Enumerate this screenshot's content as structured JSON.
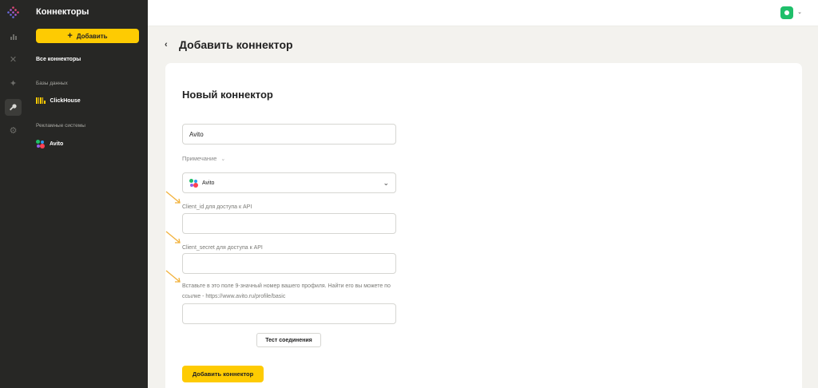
{
  "sidebar": {
    "title": "Коннекторы",
    "add_label": "Добавить",
    "all_connectors": "Все коннекторы",
    "databases_section": "Базы данных",
    "clickhouse_label": "ClickHouse",
    "ads_section": "Рекламные системы",
    "avito_label": "Avito"
  },
  "header": {
    "back_glyph": "‹",
    "page_title": "Добавить коннектор"
  },
  "form": {
    "title": "Новый коннектор",
    "name_value": "Avito",
    "note_label": "Примечание",
    "source_selected": "Avito",
    "client_id_label": "Client_id для доступа к API",
    "client_id_value": "",
    "client_secret_label": "Client_secret для доступа к API",
    "client_secret_value": "",
    "profile_hint": "Вставьте в это поле 9-значный номер вашего профиля. Найти его вы можете по ссылке - https://www.avito.ru/profile/basic",
    "profile_value": "",
    "test_button": "Тест соединения",
    "submit_button": "Добавить коннектор"
  },
  "colors": {
    "accent": "#fecb02",
    "sidebar_bg": "#272725",
    "avatar": "#1fbf6a"
  },
  "icons": {
    "rail": [
      "logo-icon",
      "chart-icon",
      "x-icon",
      "sparkle-icon",
      "key-icon",
      "gear-icon"
    ]
  }
}
